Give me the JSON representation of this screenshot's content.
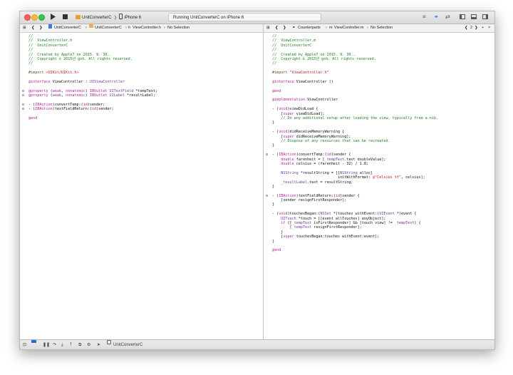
{
  "toolbar": {
    "run_icon": "play-icon",
    "stop_icon": "stop-icon",
    "scheme_name": "UnitConverterC",
    "device_name": "iPhone 6",
    "status_text": "Running UnitConverterC on iPhone 6"
  },
  "left_editor": {
    "jumpbar": [
      "UnitConverterC",
      "UnitConverterC",
      "ViewController.h",
      "No Selection"
    ],
    "lines": [
      [
        {
          "t": "//",
          "c": "comment"
        }
      ],
      [
        {
          "t": "//  ViewController.h",
          "c": "comment"
        }
      ],
      [
        {
          "t": "//  UnitConverterC",
          "c": "comment"
        }
      ],
      [
        {
          "t": "//",
          "c": "comment"
        }
      ],
      [
        {
          "t": "//  Created by Apple7 on 2015. 9. 30..",
          "c": "comment"
        }
      ],
      [
        {
          "t": "//  Copyright © 2015년 gsh. All rights reserved.",
          "c": "comment"
        }
      ],
      [
        {
          "t": "//",
          "c": "comment"
        }
      ],
      [],
      [
        {
          "t": "#import ",
          "c": "preproc"
        },
        {
          "t": "<UIKit/UIKit.h>",
          "c": "string"
        }
      ],
      [],
      [
        {
          "t": "@interface",
          "c": "keyword"
        },
        {
          "t": " ViewController : ",
          "c": "plain"
        },
        {
          "t": "UIViewController",
          "c": "type"
        }
      ],
      [],
      [
        {
          "t": "@property",
          "c": "keyword"
        },
        {
          "t": " (",
          "c": "plain"
        },
        {
          "t": "weak",
          "c": "keyword"
        },
        {
          "t": ", ",
          "c": "plain"
        },
        {
          "t": "nonatomic",
          "c": "keyword"
        },
        {
          "t": ") ",
          "c": "plain"
        },
        {
          "t": "IBOutlet",
          "c": "keyword"
        },
        {
          "t": " ",
          "c": "plain"
        },
        {
          "t": "UITextField",
          "c": "type"
        },
        {
          "t": " *tempText;",
          "c": "plain"
        }
      ],
      [
        {
          "t": "@property",
          "c": "keyword"
        },
        {
          "t": " (",
          "c": "plain"
        },
        {
          "t": "weak",
          "c": "keyword"
        },
        {
          "t": ", ",
          "c": "plain"
        },
        {
          "t": "nonatomic",
          "c": "keyword"
        },
        {
          "t": ") ",
          "c": "plain"
        },
        {
          "t": "IBOutlet",
          "c": "keyword"
        },
        {
          "t": " ",
          "c": "plain"
        },
        {
          "t": "UILabel",
          "c": "type"
        },
        {
          "t": " *resultLabel;",
          "c": "plain"
        }
      ],
      [],
      [
        {
          "t": "- (",
          "c": "plain"
        },
        {
          "t": "IBAction",
          "c": "keyword"
        },
        {
          "t": ")convertTemp:(",
          "c": "plain"
        },
        {
          "t": "id",
          "c": "keyword"
        },
        {
          "t": ")sender;",
          "c": "plain"
        }
      ],
      [
        {
          "t": "- (",
          "c": "plain"
        },
        {
          "t": "IBAction",
          "c": "keyword"
        },
        {
          "t": ")textFieldReturn:(",
          "c": "plain"
        },
        {
          "t": "id",
          "c": "keyword"
        },
        {
          "t": ")sender;",
          "c": "plain"
        }
      ],
      [],
      [
        {
          "t": "@end",
          "c": "keyword"
        }
      ]
    ],
    "breakpoints": [
      12,
      13,
      15,
      16
    ]
  },
  "right_editor": {
    "jumpbar": [
      "Counterparts",
      "ViewController.m",
      "No Selection"
    ],
    "counter": "2",
    "lines": [
      [
        {
          "t": "//",
          "c": "comment"
        }
      ],
      [
        {
          "t": "//  ViewController.m",
          "c": "comment"
        }
      ],
      [
        {
          "t": "//  UnitConverterC",
          "c": "comment"
        }
      ],
      [
        {
          "t": "//",
          "c": "comment"
        }
      ],
      [
        {
          "t": "//  Created by Apple7 on 2015. 9. 30..",
          "c": "comment"
        }
      ],
      [
        {
          "t": "//  Copyright © 2015년 gsh. All rights reserved.",
          "c": "comment"
        }
      ],
      [
        {
          "t": "//",
          "c": "comment"
        }
      ],
      [],
      [
        {
          "t": "#import ",
          "c": "preproc"
        },
        {
          "t": "\"ViewController.h\"",
          "c": "string"
        }
      ],
      [],
      [
        {
          "t": "@interface",
          "c": "keyword"
        },
        {
          "t": " ViewController ()",
          "c": "plain"
        }
      ],
      [],
      [
        {
          "t": "@end",
          "c": "keyword"
        }
      ],
      [],
      [
        {
          "t": "@implementation",
          "c": "keyword"
        },
        {
          "t": " ViewController",
          "c": "plain"
        }
      ],
      [],
      [
        {
          "t": "- (",
          "c": "plain"
        },
        {
          "t": "void",
          "c": "keyword"
        },
        {
          "t": ")viewDidLoad {",
          "c": "plain"
        }
      ],
      [
        {
          "t": "    [",
          "c": "plain"
        },
        {
          "t": "super",
          "c": "keyword"
        },
        {
          "t": " viewDidLoad];",
          "c": "plain"
        }
      ],
      [
        {
          "t": "    // Do any additional setup after loading the view, typically from a nib.",
          "c": "comment"
        }
      ],
      [
        {
          "t": "}",
          "c": "plain"
        }
      ],
      [],
      [
        {
          "t": "- (",
          "c": "plain"
        },
        {
          "t": "void",
          "c": "keyword"
        },
        {
          "t": ")didReceiveMemoryWarning {",
          "c": "plain"
        }
      ],
      [
        {
          "t": "    [",
          "c": "plain"
        },
        {
          "t": "super",
          "c": "keyword"
        },
        {
          "t": " didReceiveMemoryWarning];",
          "c": "plain"
        }
      ],
      [
        {
          "t": "    // Dispose of any resources that can be recreated.",
          "c": "comment"
        }
      ],
      [
        {
          "t": "}",
          "c": "plain"
        }
      ],
      [],
      [
        {
          "t": "- (",
          "c": "plain"
        },
        {
          "t": "IBAction",
          "c": "keyword"
        },
        {
          "t": ")convertTemp:(",
          "c": "plain"
        },
        {
          "t": "id",
          "c": "keyword"
        },
        {
          "t": ")sender {",
          "c": "plain"
        }
      ],
      [
        {
          "t": "    ",
          "c": "plain"
        },
        {
          "t": "double",
          "c": "keyword"
        },
        {
          "t": " farenheit = [",
          "c": "plain"
        },
        {
          "t": "_tempText",
          "c": "type"
        },
        {
          "t": ".text doubleValue];",
          "c": "plain"
        }
      ],
      [
        {
          "t": "    ",
          "c": "plain"
        },
        {
          "t": "double",
          "c": "keyword"
        },
        {
          "t": " celsius = (farenheit - 32) / 1.8;",
          "c": "plain"
        }
      ],
      [],
      [
        {
          "t": "    ",
          "c": "plain"
        },
        {
          "t": "NSString",
          "c": "type"
        },
        {
          "t": " *resultString = [[",
          "c": "plain"
        },
        {
          "t": "NSString",
          "c": "type"
        },
        {
          "t": " alloc]",
          "c": "plain"
        }
      ],
      [
        {
          "t": "                              initWithFormat: ",
          "c": "plain"
        },
        {
          "t": "@\"Celsius %f\"",
          "c": "string"
        },
        {
          "t": ", celsius];",
          "c": "plain"
        }
      ],
      [
        {
          "t": "    ",
          "c": "plain"
        },
        {
          "t": "_resultLabel",
          "c": "type"
        },
        {
          "t": ".text = resultString;",
          "c": "plain"
        }
      ],
      [
        {
          "t": "}",
          "c": "plain"
        }
      ],
      [],
      [
        {
          "t": "- (",
          "c": "plain"
        },
        {
          "t": "IBAction",
          "c": "keyword"
        },
        {
          "t": ")textFieldReturn:(",
          "c": "plain"
        },
        {
          "t": "id",
          "c": "keyword"
        },
        {
          "t": ")sender {",
          "c": "plain"
        }
      ],
      [
        {
          "t": "    [sender resignFirstResponder];",
          "c": "plain"
        }
      ],
      [
        {
          "t": "}",
          "c": "plain"
        }
      ],
      [],
      [
        {
          "t": "- (",
          "c": "plain"
        },
        {
          "t": "void",
          "c": "keyword"
        },
        {
          "t": ")touchesBegan:(",
          "c": "plain"
        },
        {
          "t": "NSSet",
          "c": "type"
        },
        {
          "t": " *)touches withEvent:(",
          "c": "plain"
        },
        {
          "t": "UIEvent",
          "c": "type"
        },
        {
          "t": " *)event {",
          "c": "plain"
        }
      ],
      [
        {
          "t": "    ",
          "c": "plain"
        },
        {
          "t": "UITouch",
          "c": "type"
        },
        {
          "t": " *touch = [[event allTouches] anyObject];",
          "c": "plain"
        }
      ],
      [
        {
          "t": "    ",
          "c": "plain"
        },
        {
          "t": "if",
          "c": "keyword"
        },
        {
          "t": " ([",
          "c": "plain"
        },
        {
          "t": "_tempText",
          "c": "type"
        },
        {
          "t": " isFirstResponder] && [touch view] != ",
          "c": "plain"
        },
        {
          "t": "_tempText",
          "c": "type"
        },
        {
          "t": ") {",
          "c": "plain"
        }
      ],
      [
        {
          "t": "        [",
          "c": "plain"
        },
        {
          "t": "_tempText",
          "c": "type"
        },
        {
          "t": " resignFirstResponder];",
          "c": "plain"
        }
      ],
      [
        {
          "t": "    }",
          "c": "plain"
        }
      ],
      [
        {
          "t": "    [",
          "c": "plain"
        },
        {
          "t": "super",
          "c": "keyword"
        },
        {
          "t": " touchesBegan:touches withEvent:event];",
          "c": "plain"
        }
      ],
      [
        {
          "t": "}",
          "c": "plain"
        }
      ],
      [],
      [
        {
          "t": "@end",
          "c": "keyword"
        }
      ]
    ],
    "breakpoints": [
      26,
      35
    ]
  },
  "debugbar": {
    "target_name": "UnitConverterC"
  },
  "colors": {
    "comment": "#1a7f1a",
    "keyword": "#b41e9b",
    "string": "#c41a16",
    "type": "#6d3aa0"
  }
}
